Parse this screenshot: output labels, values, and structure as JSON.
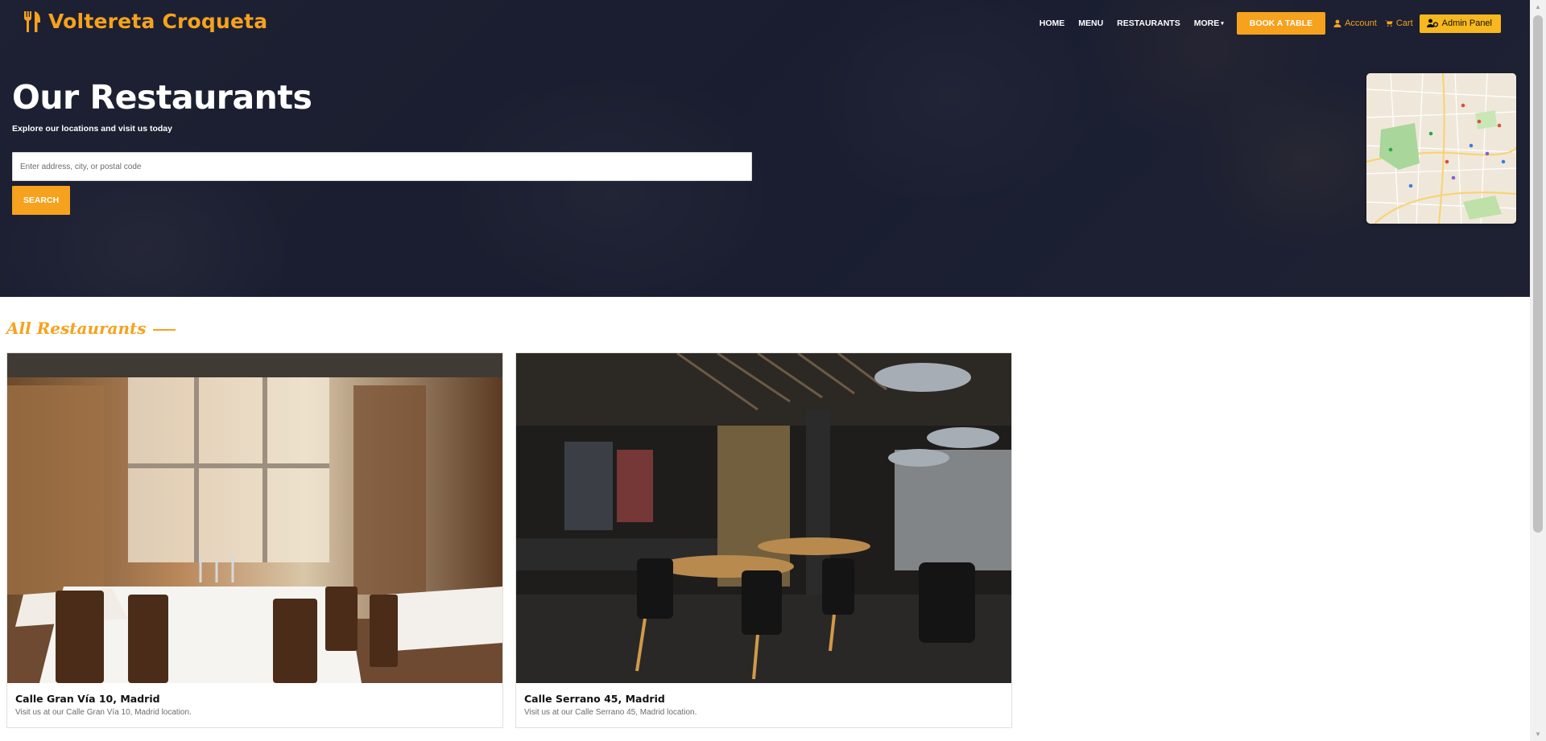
{
  "brand": {
    "name": "Voltereta Croqueta",
    "icon": "fork-knife-icon"
  },
  "nav": {
    "links": [
      "HOME",
      "MENU",
      "RESTAURANTS",
      "MORE"
    ],
    "more_caret": "▾",
    "book_label": "BOOK A TABLE",
    "account_label": "Account",
    "cart_label": "Cart",
    "admin_label": "Admin Panel"
  },
  "hero": {
    "title": "Our Restaurants",
    "subtitle": "Explore our locations and visit us today",
    "search_placeholder": "Enter address, city, or postal code",
    "search_value": "",
    "search_button": "SEARCH"
  },
  "section": {
    "title": "All Restaurants"
  },
  "restaurants": [
    {
      "name": "Calle Gran Vía 10, Madrid",
      "description": "Visit us at our Calle Gran Vía 10, Madrid location."
    },
    {
      "name": "Calle Serrano 45, Madrid",
      "description": "Visit us at our Calle Serrano 45, Madrid location."
    }
  ],
  "colors": {
    "accent": "#f6a21e",
    "admin": "#f6b81e",
    "hero_overlay": "#1b1f33"
  }
}
